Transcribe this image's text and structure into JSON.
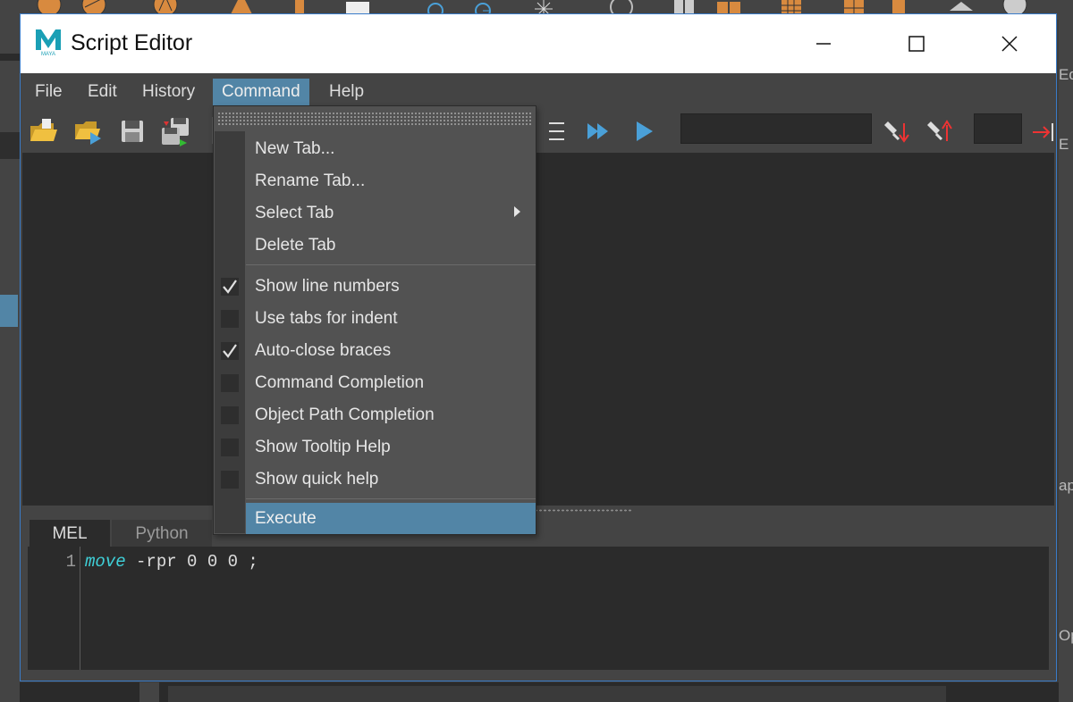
{
  "window": {
    "title": "Script Editor",
    "app_icon": "maya-logo-icon",
    "app_icon_text": "MAYA"
  },
  "menubar": {
    "items": [
      {
        "label": "File"
      },
      {
        "label": "Edit"
      },
      {
        "label": "History"
      },
      {
        "label": "Command",
        "active": true
      },
      {
        "label": "Help"
      }
    ]
  },
  "command_menu": {
    "items": [
      {
        "label": "New Tab..."
      },
      {
        "label": "Rename Tab..."
      },
      {
        "label": "Select Tab",
        "submenu": true
      },
      {
        "label": "Delete Tab"
      },
      {
        "label": "Show line numbers",
        "checked": true
      },
      {
        "label": "Use tabs for indent",
        "checked": false
      },
      {
        "label": "Auto-close braces",
        "checked": true
      },
      {
        "label": "Command Completion",
        "checked": false
      },
      {
        "label": "Object Path Completion",
        "checked": false
      },
      {
        "label": "Show Tooltip Help",
        "checked": false
      },
      {
        "label": "Show quick help",
        "checked": false
      },
      {
        "label": "Execute",
        "highlighted": true
      }
    ]
  },
  "toolbar": {
    "icons": [
      "open-script-icon",
      "source-script-icon",
      "save-script-icon",
      "save-selected-icon",
      "line-numbers-icon",
      "execute-all-icon",
      "execute-icon",
      "search-down-icon",
      "search-up-icon",
      "goto-line-icon"
    ]
  },
  "tabs": [
    {
      "label": "MEL",
      "active": true
    },
    {
      "label": "Python",
      "active": false
    }
  ],
  "editor": {
    "line_number": "1",
    "command": "move",
    "args": " -rpr 0 0 0 ;"
  },
  "colors": {
    "accent": "#5285a6",
    "panel": "#444444",
    "field": "#2b2b2b",
    "code_keyword": "#3fd0d8",
    "window_border": "#3a7cc9"
  }
}
